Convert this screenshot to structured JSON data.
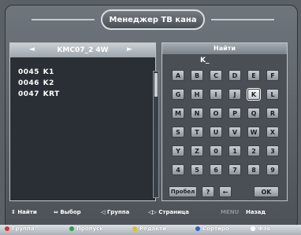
{
  "window": {
    "title": "Менеджер ТВ кана"
  },
  "satellite": {
    "name": "KMC07_2 4W",
    "prev_icon": "left-arrow-icon",
    "next_icon": "right-arrow-icon"
  },
  "channels": [
    {
      "number": "0045",
      "name": "K1"
    },
    {
      "number": "0046",
      "name": "K2"
    },
    {
      "number": "0047",
      "name": "KRT"
    }
  ],
  "search": {
    "title": "Найти",
    "query": "K_",
    "keys": [
      "A",
      "B",
      "C",
      "D",
      "E",
      "F",
      "G",
      "H",
      "I",
      "J",
      "K",
      "L",
      "M",
      "N",
      "O",
      "P",
      "Q",
      "R",
      "S",
      "T",
      "U",
      "V",
      "W",
      "X",
      "Y",
      "Z",
      "0",
      "1",
      "2",
      "3",
      "4",
      "5",
      "6",
      "7",
      "8",
      "9"
    ],
    "selected_key": "K",
    "space_label": "Пробел",
    "help_label": "?",
    "back_label": "←",
    "ok_label": "OK"
  },
  "help_bar": {
    "find": "Найти",
    "select": "Выбор",
    "group": "Группа",
    "page": "Страница",
    "menu": "MENU",
    "back": "Назад"
  },
  "bottom_bar": {
    "items": [
      {
        "label": "Группа",
        "color": "#e03030"
      },
      {
        "label": "Пропуск",
        "color": "#30a040"
      },
      {
        "label": "Редакти",
        "color": "#e0c020"
      },
      {
        "label": "Сортиро",
        "color": "#3060d0"
      },
      {
        "label": "Фав",
        "color": "#ffffff"
      }
    ]
  }
}
